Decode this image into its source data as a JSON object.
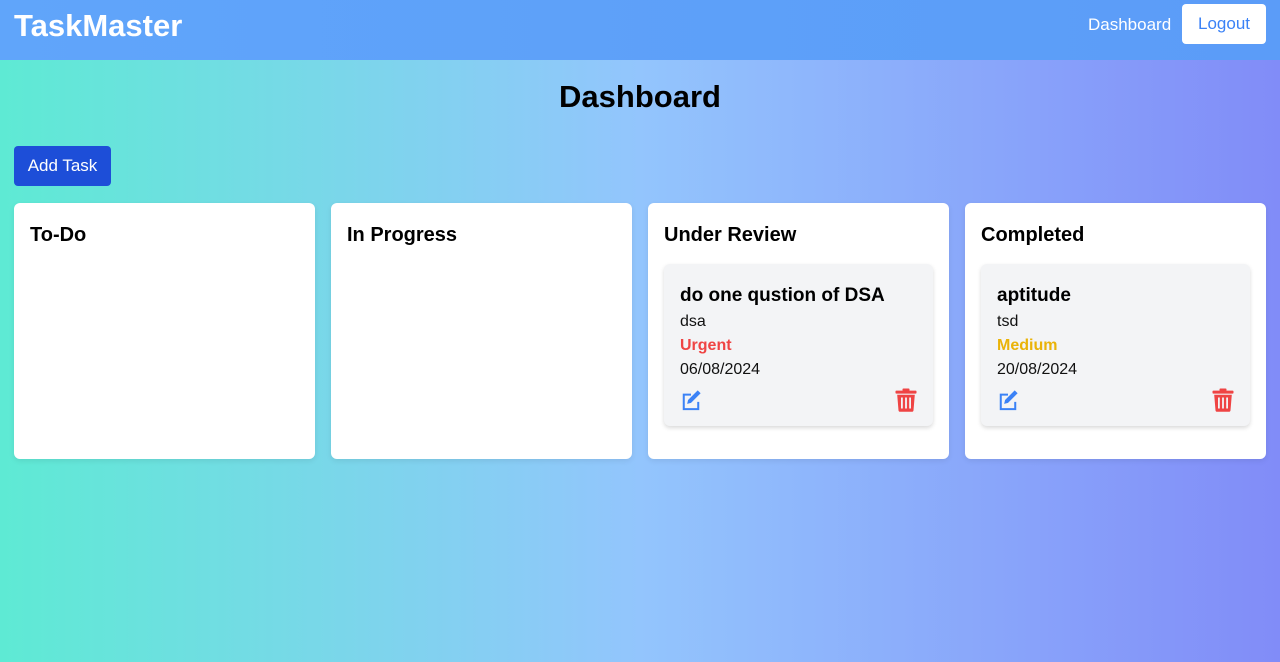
{
  "nav": {
    "brand": "TaskMaster",
    "dashboard_link": "Dashboard",
    "logout_label": "Logout"
  },
  "page": {
    "title": "Dashboard",
    "add_task_label": "Add Task"
  },
  "colors": {
    "priority_urgent": "#ef4444",
    "priority_medium": "#eab308",
    "edit_icon": "#3b82f6",
    "delete_icon": "#ef4444"
  },
  "columns": [
    {
      "title": "To-Do",
      "tasks": []
    },
    {
      "title": "In Progress",
      "tasks": []
    },
    {
      "title": "Under Review",
      "tasks": [
        {
          "title": "do one qustion of DSA",
          "description": "dsa",
          "priority": "Urgent",
          "date": "06/08/2024",
          "icons": [
            "edit-icon",
            "trash-icon"
          ]
        }
      ]
    },
    {
      "title": "Completed",
      "tasks": [
        {
          "title": "aptitude",
          "description": "tsd",
          "priority": "Medium",
          "date": "20/08/2024",
          "icons": [
            "edit-icon",
            "trash-icon"
          ]
        }
      ]
    }
  ]
}
